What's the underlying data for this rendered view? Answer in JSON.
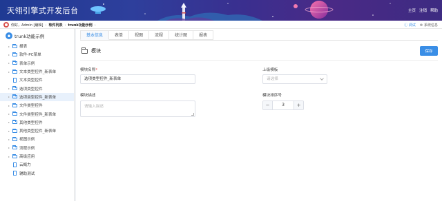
{
  "header": {
    "title": "天翎引擎式开发后台",
    "nav": [
      "主页",
      "注销",
      "帮助"
    ]
  },
  "breadcrumb": {
    "user": "你好，Admin [编辑]",
    "items": [
      "软件列表",
      "trunk功能示例"
    ],
    "right": [
      "调试",
      "系统信息"
    ]
  },
  "sidebar": {
    "root": "trunk功能示例",
    "items": [
      {
        "label": "报表",
        "type": "folder"
      },
      {
        "label": "软件-PC菜单",
        "type": "folder"
      },
      {
        "label": "表单示例",
        "type": "folder"
      },
      {
        "label": "文本类型控件_新表单",
        "type": "folder"
      },
      {
        "label": "文本类型控件",
        "type": "file"
      },
      {
        "label": "选项类型控件",
        "type": "folder"
      },
      {
        "label": "选项类型控件_新表单",
        "type": "folder",
        "active": true
      },
      {
        "label": "文件类型控件",
        "type": "folder"
      },
      {
        "label": "文件类型控件_新表单",
        "type": "folder"
      },
      {
        "label": "其他类型控件",
        "type": "folder"
      },
      {
        "label": "其他类型控件_新表单",
        "type": "folder"
      },
      {
        "label": "视图示例",
        "type": "folder"
      },
      {
        "label": "流程示例",
        "type": "folder"
      },
      {
        "label": "高级应用",
        "type": "folder"
      },
      {
        "label": "云概力",
        "type": "file"
      },
      {
        "label": "辅助测试",
        "type": "file"
      }
    ]
  },
  "tabs": [
    "基本信息",
    "表单",
    "视图",
    "流程",
    "统计图",
    "报表"
  ],
  "section": {
    "title": "模块",
    "save_label": "保存"
  },
  "form": {
    "name_label": "模块名称",
    "name_required": "*",
    "name_value": "选项类型控件_新表单",
    "parent_label": "上级模板",
    "parent_placeholder": "请选择",
    "desc_label": "模块描述",
    "desc_placeholder": "请输入描述",
    "order_label": "模块排序号",
    "order_value": "3",
    "minus": "−",
    "plus": "+"
  },
  "colors": {
    "accent": "#3a8ee6",
    "header_start": "#1f3a93",
    "header_end": "#3d2b82"
  }
}
